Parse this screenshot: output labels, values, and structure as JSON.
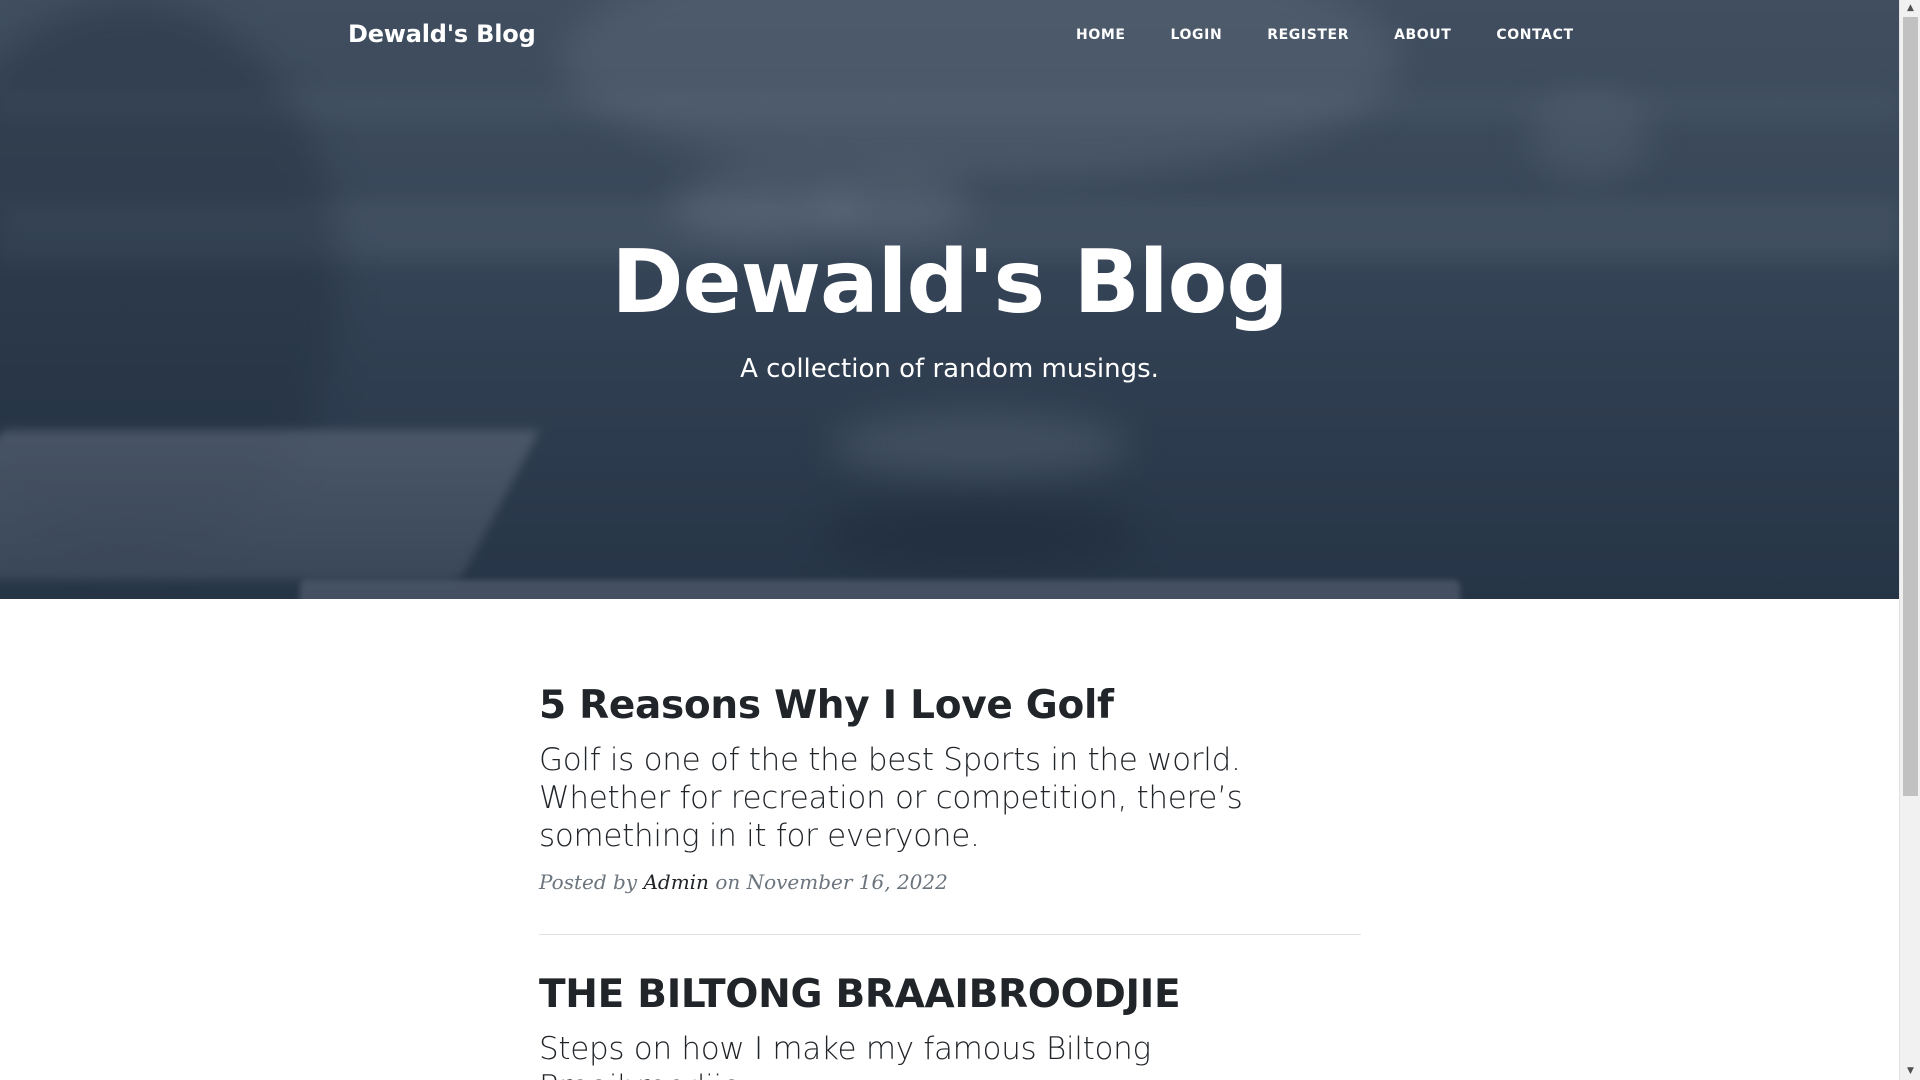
{
  "nav": {
    "brand": "Dewald's Blog",
    "links": [
      "HOME",
      "LOGIN",
      "REGISTER",
      "ABOUT",
      "CONTACT"
    ]
  },
  "header": {
    "title": "Dewald's Blog",
    "subtitle": "A collection of random musings."
  },
  "posts": [
    {
      "title": "5 Reasons Why I Love Golf",
      "subtitle": "Golf is one of the the best Sports in the world. Whether for recreation or competition, there’s something in it for everyone.",
      "meta_prefix": "Posted by",
      "author": "Admin",
      "meta_on": "on",
      "date": "November 16, 2022"
    },
    {
      "title": "THE BILTONG BRAAIBROODJIE",
      "subtitle": "Steps on how I make my famous Biltong Braaibroodjie"
    }
  ],
  "scrollbar": {
    "up_icon": "triangle-up-icon",
    "down_icon": "triangle-down-icon"
  }
}
